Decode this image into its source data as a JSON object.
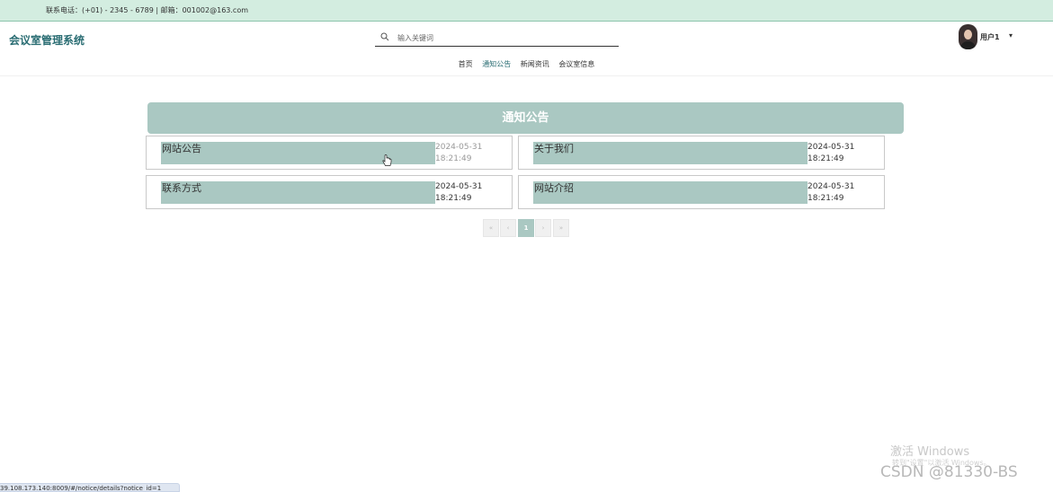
{
  "topbar": {
    "contact": "联系电话：(+01) - 2345 - 6789 | 邮箱：001002@163.com"
  },
  "header": {
    "logo": "会议室管理系统",
    "search": {
      "placeholder": "输入关键词",
      "value": "",
      "icon": "search-icon"
    },
    "nav": [
      {
        "label": "首页",
        "active": false
      },
      {
        "label": "通知公告",
        "active": true
      },
      {
        "label": "新闻资讯",
        "active": false
      },
      {
        "label": "会议室信息",
        "active": false
      }
    ],
    "user": {
      "name": "用户1",
      "caret": "▾"
    }
  },
  "main": {
    "section_title": "通知公告",
    "notices": [
      {
        "title": "网站公告",
        "date": "2024-05-31\n18:21:49"
      },
      {
        "title": "关于我们",
        "date": "2024-05-31\n18:21:49"
      },
      {
        "title": "联系方式",
        "date": "2024-05-31\n18:21:49"
      },
      {
        "title": "网站介绍",
        "date": "2024-05-31\n18:21:49"
      }
    ],
    "pagination": {
      "first": "«",
      "prev": "‹",
      "current": "1",
      "next": "›",
      "last": "»"
    }
  },
  "statusbar": {
    "url": "39.108.173.140:8009/#/notice/details?notice_id=1"
  },
  "watermark": {
    "activate_title": "激活 Windows",
    "activate_sub": "转到\"设置\"以激活 Windows。",
    "csdn": "CSDN @81330-BS"
  },
  "colors": {
    "accent": "#2a6d73",
    "topbar_bg": "#d3ede0",
    "highlight": "#aac8c2"
  }
}
